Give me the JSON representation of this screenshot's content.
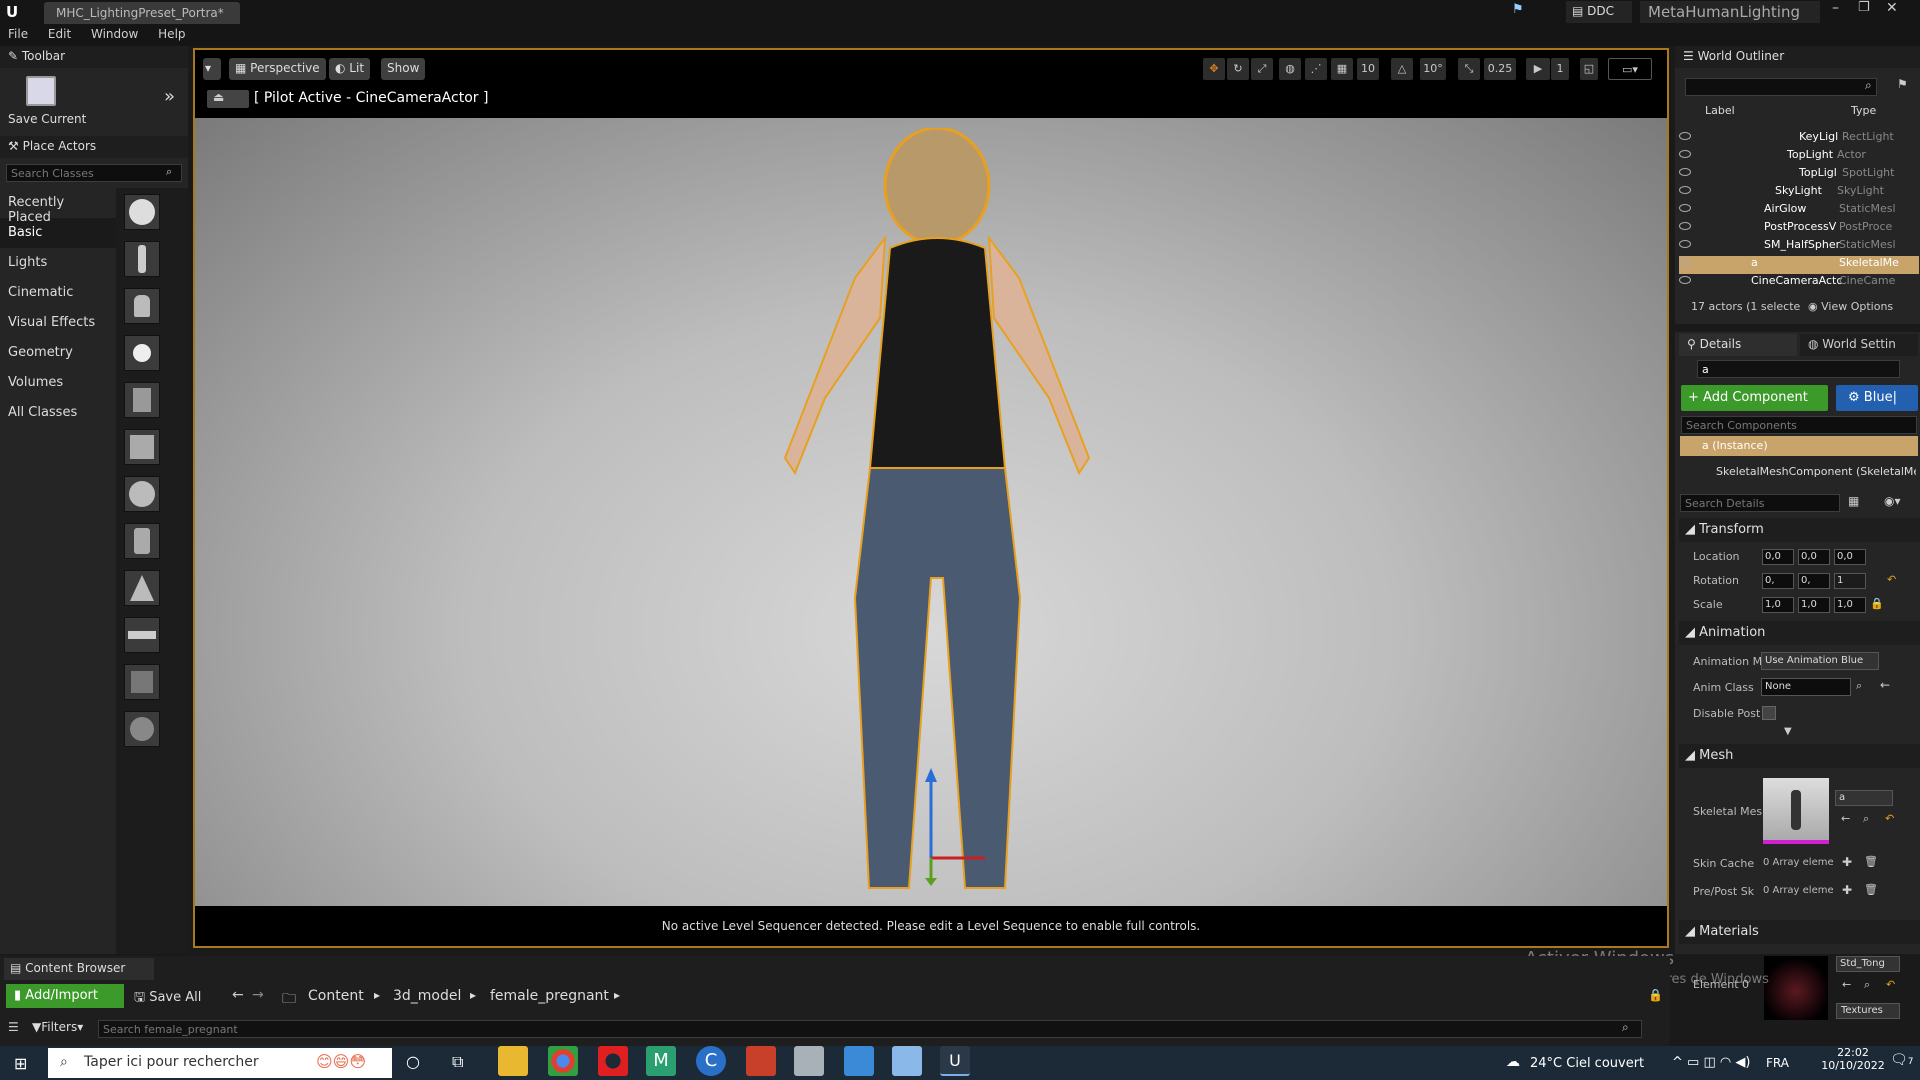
{
  "title_tab": "MHC_LightingPreset_Portra*",
  "app_label": "MetaHumanLighting",
  "ddc_label": "DDC",
  "menu": [
    "File",
    "Edit",
    "Window",
    "Help"
  ],
  "toolbar": {
    "title": "Toolbar",
    "save_label": "Save Current"
  },
  "place_actors": {
    "title": "Place Actors",
    "search_placeholder": "Search Classes",
    "categories": [
      "Recently Placed",
      "Basic",
      "Lights",
      "Cinematic",
      "Visual Effects",
      "Geometry",
      "Volumes",
      "All Classes"
    ],
    "selected": "Basic"
  },
  "viewport": {
    "perspective": "Perspective",
    "lit": "Lit",
    "show": "Show",
    "pilot": "[ Pilot Active - CineCameraActor ]",
    "grid_snap": "10",
    "rot_snap": "10°",
    "scale_snap": "0.25",
    "cam_speed": "1",
    "sequencer_msg": "No active Level Sequencer detected. Please edit a Level Sequence to enable full controls."
  },
  "outliner": {
    "title": "World Outliner",
    "col_label": "Label",
    "col_type": "Type",
    "rows": [
      {
        "label": "KeyLigl",
        "type": "RectLight"
      },
      {
        "label": "TopLight",
        "type": "Actor"
      },
      {
        "label": "TopLigl",
        "type": "SpotLight"
      },
      {
        "label": "SkyLight",
        "type": "SkyLight"
      },
      {
        "label": "AirGlow",
        "type": "StaticMesl"
      },
      {
        "label": "PostProcessV",
        "type": "PostProce"
      },
      {
        "label": "SM_HalfSpher",
        "type": "StaticMesl"
      },
      {
        "label": "a",
        "type": "SkeletalMe"
      },
      {
        "label": "CineCameraActc",
        "type": "CineCame"
      }
    ],
    "footer": "17 actors (1 selecte",
    "view_options": "View Options"
  },
  "details": {
    "tab": "Details",
    "world_tab": "World Settin",
    "name_value": "a",
    "add_component": "+ Add Component",
    "blueprint": "Blue|",
    "search_components": "Search Components",
    "instance": "a (Instance)",
    "component": "SkeletalMeshComponent (SkeletalMe",
    "search_details": "Search Details",
    "transform": "Transform",
    "location": "Location",
    "rotation": "Rotation",
    "scale": "Scale",
    "loc_vals": [
      "0,0",
      "0,0",
      "0,0"
    ],
    "rot_vals": [
      "0,",
      "0,",
      "1"
    ],
    "scale_vals": [
      "1,0",
      "1,0",
      "1,0"
    ],
    "animation": "Animation",
    "anim_mode": "Animation M",
    "anim_mode_val": "Use Animation Blue",
    "anim_class": "Anim Class",
    "anim_class_val": "None",
    "disable_post": "Disable Post",
    "mesh": "Mesh",
    "skeletal_mesh": "Skeletal Mes",
    "mesh_val": "a",
    "skin_cache": "Skin Cache",
    "array": "0 Array eleme",
    "prepost": "Pre/Post Sk",
    "materials": "Materials",
    "element": "Element 0",
    "mat_val": "Std_Tong",
    "textures": "Textures"
  },
  "watermark": {
    "line1": "Activer Windows",
    "line2": "Accédez aux paramètres de Windows"
  },
  "content_browser": {
    "title": "Content Browser",
    "add_import": "Add/Import",
    "save_all": "Save All",
    "path": [
      "Content",
      "3d_model",
      "female_pregnant"
    ],
    "filters": "Filters",
    "search_placeholder": "Search female_pregnant"
  },
  "taskbar": {
    "search": "Taper ici pour rechercher",
    "weather": "24°C  Ciel couvert",
    "lang": "FRA",
    "time": "22:02",
    "date": "10/10/2022",
    "notif_count": "7"
  }
}
